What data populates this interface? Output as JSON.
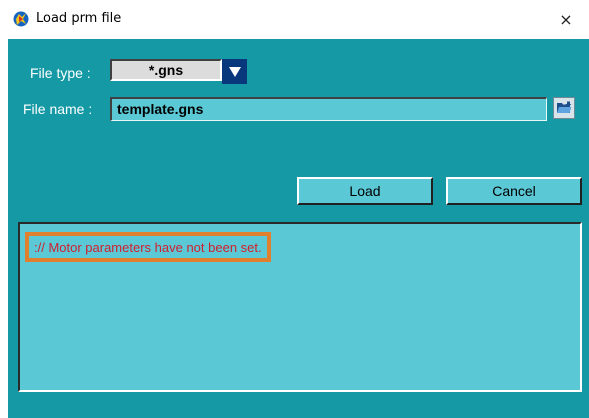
{
  "window": {
    "title": "Load prm file",
    "close_glyph": "×",
    "icon": "app-logo-icon"
  },
  "form": {
    "file_type_label": "File type :",
    "file_type_value": "*.gns",
    "file_name_label": "File name :",
    "file_name_value": "template.gns"
  },
  "buttons": {
    "load": "Load",
    "cancel": "Cancel"
  },
  "log": {
    "message": ":// Motor parameters have not been set.",
    "highlight_color": "#e07f2e",
    "message_color": "#d0202e"
  },
  "colors": {
    "dialog_bg": "#1499a5",
    "field_bg": "#5bc8d6",
    "dropdown_bg": "#08377c"
  },
  "icons": {
    "dropdown": "triangle-down-icon",
    "browse": "folder-open-icon"
  }
}
